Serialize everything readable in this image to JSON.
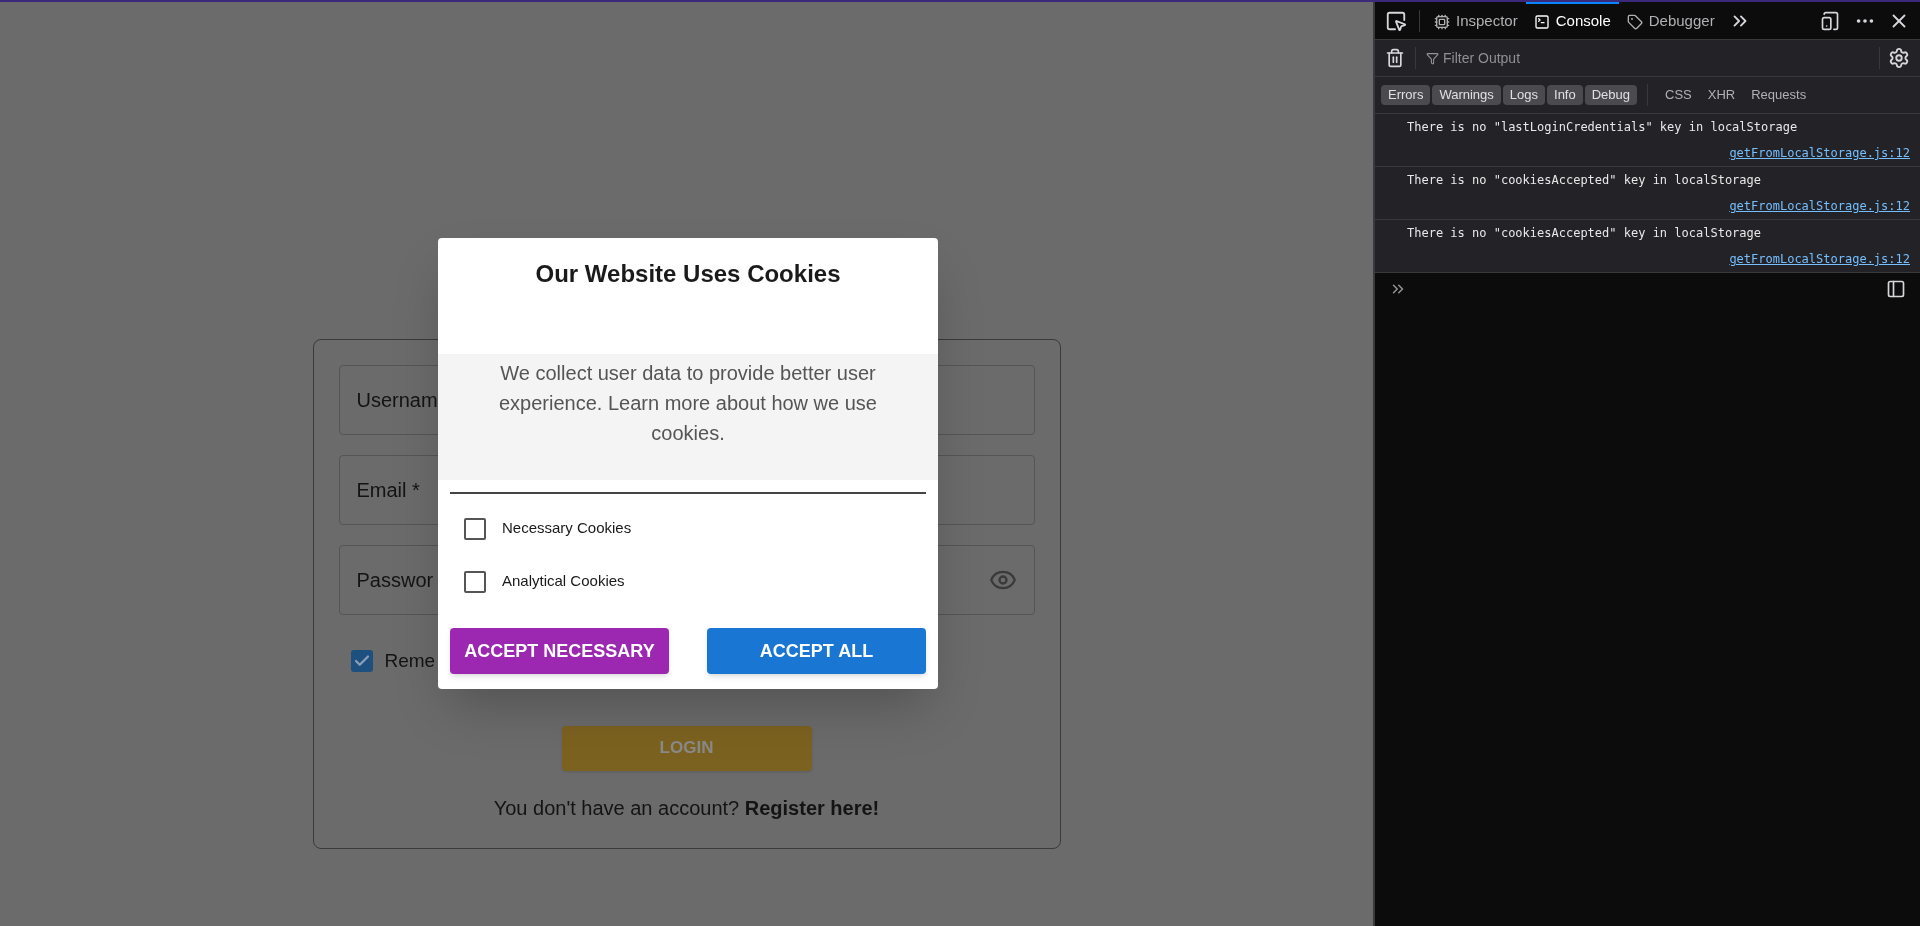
{
  "login_form": {
    "fields": [
      {
        "label": "Usernam",
        "kind": "text"
      },
      {
        "label": "Email *",
        "kind": "text"
      },
      {
        "label": "Passwor",
        "kind": "password"
      }
    ],
    "remember": {
      "label": "Reme",
      "checked": true
    },
    "login_button": {
      "label": "LOGIN",
      "disabled": true
    },
    "register_prompt": "You don't have an account?",
    "register_link": "Register here!"
  },
  "cookie_dialog": {
    "title": "Our Website Uses Cookies",
    "description": "We collect user data to provide better user experience. Learn more about how we use cookies.",
    "options": [
      {
        "label": "Necessary Cookies",
        "checked": false
      },
      {
        "label": "Analytical Cookies",
        "checked": false
      }
    ],
    "buttons": [
      {
        "label": "ACCEPT NECESSARY",
        "kind": "secondary"
      },
      {
        "label": "ACCEPT ALL",
        "kind": "primary"
      }
    ]
  },
  "devtools": {
    "tabs": [
      {
        "label": "Inspector",
        "kind": "inspector",
        "selected": false
      },
      {
        "label": "Console",
        "kind": "console",
        "selected": true
      },
      {
        "label": "Debugger",
        "kind": "debugger",
        "selected": false
      }
    ],
    "filter": {
      "placeholder": "Filter Output"
    },
    "levels": [
      {
        "label": "Errors",
        "selected": true
      },
      {
        "label": "Warnings",
        "selected": true
      },
      {
        "label": "Logs",
        "selected": true
      },
      {
        "label": "Info",
        "selected": true
      },
      {
        "label": "Debug",
        "selected": true
      }
    ],
    "types": [
      {
        "label": "CSS",
        "selected": false
      },
      {
        "label": "XHR",
        "selected": false
      },
      {
        "label": "Requests",
        "selected": false
      }
    ],
    "messages": [
      {
        "text": "There is no \"lastLoginCredentials\" key in localStorage",
        "source": "getFromLocalStorage.js:12"
      },
      {
        "text": "There is no \"cookiesAccepted\" key in localStorage",
        "source": "getFromLocalStorage.js:12"
      },
      {
        "text": "There is no \"cookiesAccepted\" key in localStorage",
        "source": "getFromLocalStorage.js:12"
      }
    ]
  }
}
